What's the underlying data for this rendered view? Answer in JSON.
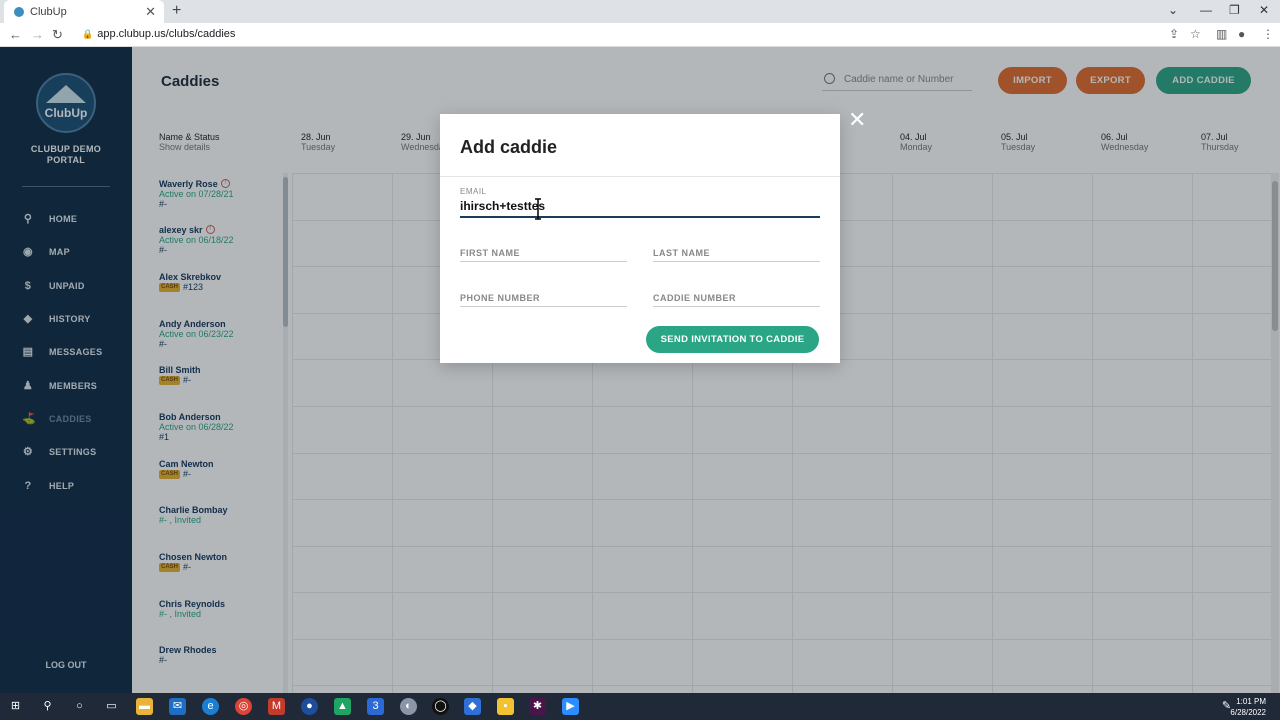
{
  "browser": {
    "tab_title": "ClubUp",
    "url": "app.clubup.us/clubs/caddies"
  },
  "sidebar": {
    "logo_text": "ClubUp",
    "portal_name": "CLUBUP DEMO PORTAL",
    "items": [
      {
        "label": "HOME",
        "icon": "pin-icon"
      },
      {
        "label": "MAP",
        "icon": "map-pin-icon"
      },
      {
        "label": "UNPAID",
        "icon": "dollar-icon"
      },
      {
        "label": "HISTORY",
        "icon": "diamond-icon"
      },
      {
        "label": "MESSAGES",
        "icon": "chat-icon"
      },
      {
        "label": "MEMBERS",
        "icon": "person-icon"
      },
      {
        "label": "CADDIES",
        "icon": "caddie-icon"
      },
      {
        "label": "SETTINGS",
        "icon": "gear-icon"
      },
      {
        "label": "HELP",
        "icon": "help-icon"
      }
    ],
    "active": "CADDIES",
    "logout": "LOG OUT"
  },
  "header": {
    "title": "Caddies",
    "search_placeholder": "Caddie name or Number",
    "import_label": "IMPORT",
    "export_label": "EXPORT",
    "add_label": "ADD CADDIE"
  },
  "columns": {
    "name_header": "Name & Status",
    "name_sub": "Show details",
    "days": [
      {
        "date": "28. Jun",
        "day": "Tuesday"
      },
      {
        "date": "29. Jun",
        "day": "Wednesday"
      },
      {
        "date": "04. Jul",
        "day": "Monday"
      },
      {
        "date": "05. Jul",
        "day": "Tuesday"
      },
      {
        "date": "06. Jul",
        "day": "Wednesday"
      },
      {
        "date": "07. Jul",
        "day": "Thursday"
      }
    ]
  },
  "caddies": [
    {
      "name": "Waverly Rose",
      "status": "Active on 07/28/21",
      "number": "#-",
      "warn": true
    },
    {
      "name": "alexey skr",
      "status": "Active on 06/18/22",
      "number": "#-",
      "warn": true
    },
    {
      "name": "Alex Skrebkov",
      "cash": "CASH",
      "number": "#123"
    },
    {
      "name": "Andy Anderson",
      "status": "Active on 06/23/22",
      "number": "#-"
    },
    {
      "name": "Bill Smith",
      "cash": "CASH",
      "number": "#-"
    },
    {
      "name": "Bob Anderson",
      "status": "Active on 06/28/22",
      "number": "#1"
    },
    {
      "name": "Cam Newton",
      "cash": "CASH",
      "number": "#-"
    },
    {
      "name": "Charlie Bombay",
      "status": "#- , Invited"
    },
    {
      "name": "Chosen Newton",
      "cash": "CASH",
      "number": "#-"
    },
    {
      "name": "Chris Reynolds",
      "status": "#- , Invited"
    },
    {
      "name": "Drew Rhodes",
      "number": "#-"
    }
  ],
  "modal": {
    "title": "Add caddie",
    "email_label": "EMAIL",
    "email_value": "ihirsch+testtes",
    "first_name": "FIRST NAME",
    "last_name": "LAST NAME",
    "phone": "PHONE NUMBER",
    "caddie_number": "CADDIE NUMBER",
    "send_label": "SEND INVITATION TO CADDIE"
  },
  "taskbar": {
    "time": "1:01 PM",
    "date": "6/28/2022"
  },
  "colors": {
    "sidebar": "#0f2a45",
    "accent_green": "#2aa585",
    "accent_orange": "#e36b2c",
    "cash_badge": "#e9b12f"
  }
}
